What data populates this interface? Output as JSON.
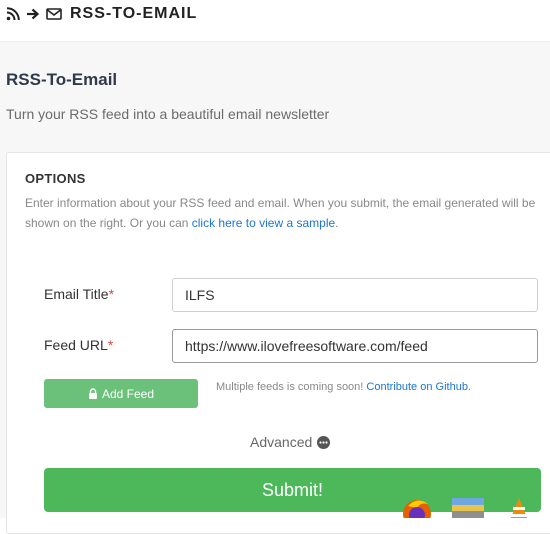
{
  "header": {
    "brand": "RSS-TO-EMAIL",
    "icons": [
      "rss-icon",
      "arrow-right-icon",
      "envelope-icon"
    ]
  },
  "page": {
    "title": "RSS-To-Email",
    "subtitle": "Turn your RSS feed into a beautiful email newsletter"
  },
  "options": {
    "title": "OPTIONS",
    "description": "Enter information about your RSS feed and email. When you submit, the email generated will be shown on the right. Or you can ",
    "sample_link": "click here to view a sample",
    "description_end": "."
  },
  "form": {
    "email_title": {
      "label": "Email Title",
      "required_mark": "*",
      "value": "ILFS"
    },
    "feed_url": {
      "label": "Feed URL",
      "required_mark": "*",
      "value": "https://www.ilovefreesoftware.com/feed"
    },
    "add_feed_label": "Add Feed",
    "feeds_note": "Multiple feeds is coming soon! ",
    "feeds_link": "Contribute on Github",
    "feeds_note_end": ".",
    "advanced_label": "Advanced",
    "submit_label": "Submit!"
  },
  "colors": {
    "accent_green": "#4cb85a",
    "add_feed_green": "#6cc17a",
    "link_blue": "#1f74d1",
    "required_red": "#e0453a"
  }
}
